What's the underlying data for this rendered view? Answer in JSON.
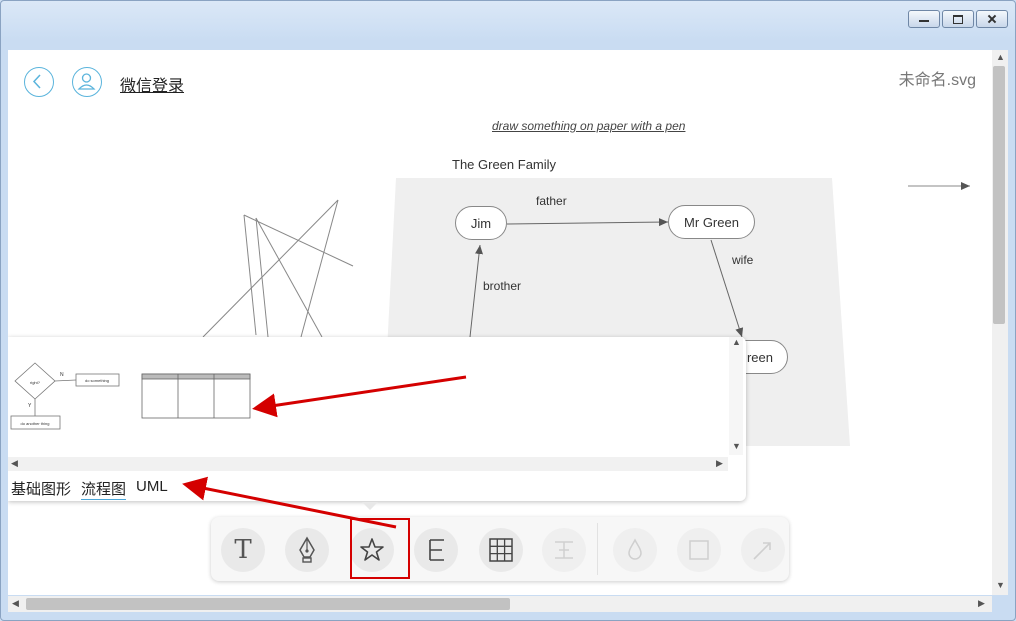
{
  "window": {
    "min_icon": "minimize-icon",
    "max_icon": "restore-icon",
    "close_icon": "close-icon"
  },
  "header": {
    "back_icon": "back-arrow-icon",
    "user_icon": "user-icon",
    "login_label": "微信登录",
    "filename": "未命名.svg"
  },
  "canvas": {
    "subtitle": "draw something on paper with a pen",
    "family_title": "The Green Family",
    "nodes": {
      "jim": "Jim",
      "mr_green": "Mr Green",
      "green_partial": "reen"
    },
    "edges": {
      "father": "father",
      "wife": "wife",
      "brother": "brother"
    }
  },
  "shape_panel": {
    "flow_thumb": {
      "decision": "right?",
      "yes": "Y",
      "no": "N",
      "action": "do something",
      "other": "do another thing"
    },
    "tabs": [
      "基础图形",
      "流程图",
      "UML"
    ],
    "active_tab": "流程图"
  },
  "toolbar": {
    "tools": [
      {
        "name": "text-tool",
        "icon": "text-T-icon",
        "glyph": "T",
        "enabled": true
      },
      {
        "name": "pen-tool",
        "icon": "pen-nib-icon",
        "enabled": true
      },
      {
        "name": "shape-tool",
        "icon": "star-icon",
        "enabled": true
      },
      {
        "name": "mindmap-tool",
        "icon": "mindmap-branch-icon",
        "enabled": true
      },
      {
        "name": "table-tool",
        "icon": "grid-table-icon",
        "enabled": true
      },
      {
        "name": "align-tool",
        "icon": "align-icon",
        "enabled": false
      },
      {
        "name": "fill-tool",
        "icon": "drop-icon",
        "enabled": false
      },
      {
        "name": "border-tool",
        "icon": "square-icon",
        "enabled": false
      },
      {
        "name": "line-tool",
        "icon": "arrow-line-icon",
        "enabled": false
      }
    ]
  },
  "colors": {
    "accent": "#4aa6d8",
    "annotation": "#d40000"
  }
}
